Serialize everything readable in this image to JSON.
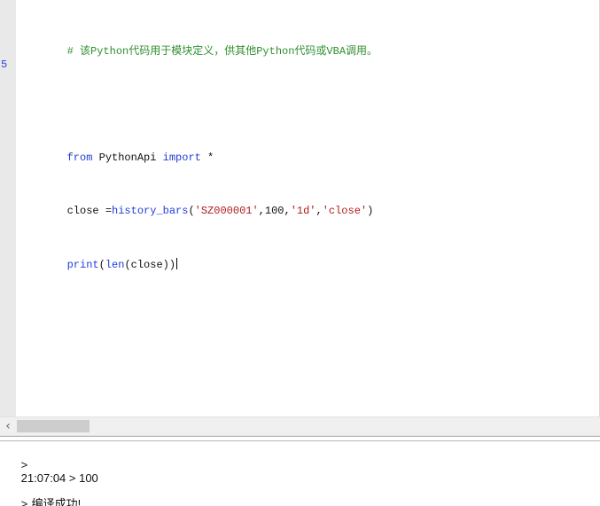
{
  "editor": {
    "gutter_line_number": "5",
    "lines": [
      {
        "comment": "# 该Python代码用于模块定义，供其他Python代码或VBA调用。"
      },
      {
        "blank": ""
      },
      {
        "kw_from": "from",
        "text_mid": " PythonApi ",
        "kw_import": "import",
        "text_end": " *"
      },
      {
        "text_start": "close =",
        "fn": "history_bars",
        "open_paren": "(",
        "s1": "'SZ000001'",
        "comma1": ",",
        "n1": "100",
        "comma2": ",",
        "s2": "'1d'",
        "comma3": ",",
        "s3": "'close'",
        "close_paren": ")"
      },
      {
        "fn_print": "print",
        "open": "(",
        "fn_len": "len",
        "inner": "(close))"
      }
    ]
  },
  "output": {
    "lines": [
      {
        "prompt": ">",
        "text": ""
      },
      {
        "prompt": "",
        "text": "21:07:04 > 100"
      },
      {
        "prompt": ">",
        "text": "编译成功!"
      }
    ]
  },
  "icons": {
    "scroll_left": "left-arrow-icon"
  }
}
